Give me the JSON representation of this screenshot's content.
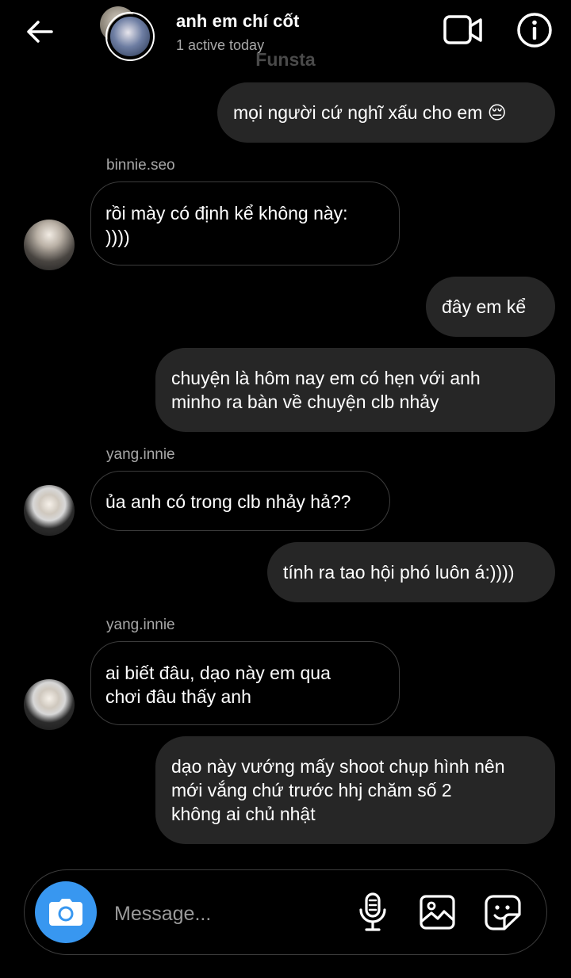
{
  "header": {
    "title": "anh em chí cốt",
    "status": "1 active today",
    "back_icon": "arrow-left-icon",
    "video_icon": "video-camera-icon",
    "info_icon": "info-icon"
  },
  "account_label": "Funsta",
  "messages": [
    {
      "type": "outgoing",
      "text": "mọi người cứ nghĩ xấu cho em 😔"
    },
    {
      "type": "incoming",
      "sender": "binnie.seo",
      "text": "rồi mày có định kể không này:\n))))"
    },
    {
      "type": "outgoing",
      "text": "đây em kể"
    },
    {
      "type": "outgoing",
      "text": "chuyện là hôm nay em có hẹn với anh\nminho ra bàn về chuyện clb nhảy"
    },
    {
      "type": "incoming",
      "sender": "yang.innie",
      "text": "ủa anh có trong clb nhảy hả??"
    },
    {
      "type": "outgoing",
      "text": "tính ra tao hội phó luôn á:))))"
    },
    {
      "type": "incoming",
      "sender": "yang.innie",
      "text": "ai biết đâu, dạo này em qua\nchơi đâu thấy anh"
    },
    {
      "type": "outgoing",
      "text": "dạo này vướng mấy shoot chụp hình nên\nmới vắng chứ trước hhj chăm số 2\nkhông ai chủ nhật"
    }
  ],
  "composer": {
    "placeholder": "Message...",
    "camera_icon": "camera-icon",
    "mic_icon": "microphone-icon",
    "gallery_icon": "image-icon",
    "sticker_icon": "sticker-icon"
  },
  "colors": {
    "background": "#000000",
    "outgoing_bubble": "#262626",
    "incoming_border": "#3c3c3c",
    "camera_button": "#3897f0",
    "secondary_text": "#a8a8a8"
  }
}
